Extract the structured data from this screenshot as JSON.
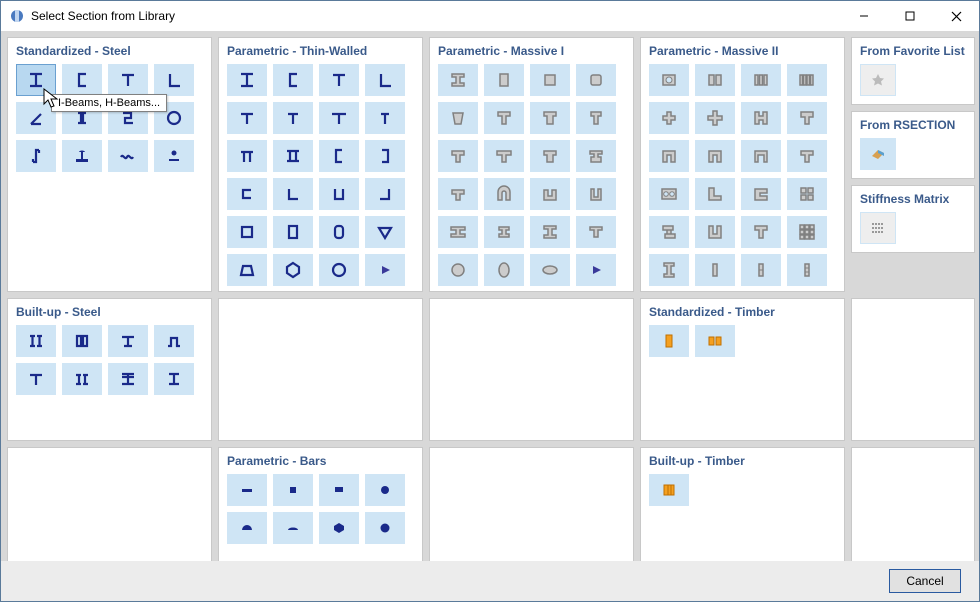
{
  "window": {
    "title": "Select Section from Library"
  },
  "panels": {
    "std_steel": {
      "title": "Standardized - Steel"
    },
    "thin_walled": {
      "title": "Parametric - Thin-Walled"
    },
    "massive1": {
      "title": "Parametric - Massive I"
    },
    "massive2": {
      "title": "Parametric - Massive II"
    },
    "builtup_steel": {
      "title": "Built-up - Steel"
    },
    "std_timber": {
      "title": "Standardized - Timber"
    },
    "bars": {
      "title": "Parametric - Bars"
    },
    "builtup_timber": {
      "title": "Built-up - Timber"
    },
    "favorite": {
      "title": "From Favorite List"
    },
    "rsection": {
      "title": "From RSECTION"
    },
    "stiffness": {
      "title": "Stiffness Matrix"
    }
  },
  "tooltip": {
    "text": "I-Beams, H-Beams..."
  },
  "buttons": {
    "cancel": "Cancel"
  },
  "icons": {
    "std_steel": [
      "i-section",
      "channel",
      "tee",
      "angle",
      "angle-mirror",
      "double-channel",
      "zee",
      "pipe",
      "z-section",
      "wide-flange",
      "wave",
      "round-bar"
    ],
    "thin_walled": [
      "i-thin",
      "channel-thin",
      "tee-thin",
      "angle-thin",
      "tee-flat",
      "tee-alt",
      "tee-wide",
      "tee-narrow",
      "pi",
      "double-i",
      "channel-left",
      "channel-right",
      "c-shape",
      "l-shape",
      "u-shape",
      "l-right",
      "square-hollow",
      "rect-hollow",
      "round-hollow",
      "triangle-hollow",
      "trapezoid",
      "hexagon",
      "circle",
      "more"
    ],
    "massive1": [
      "i-solid",
      "rect-solid",
      "square-solid",
      "rect-tall",
      "trap-solid",
      "t-down",
      "cross",
      "t-up",
      "u-solid",
      "u-wide",
      "t-solid",
      "t-cap",
      "cap",
      "arch",
      "omega",
      "u-narrow",
      "i-wide",
      "i-narrow",
      "h-solid",
      "i-thin",
      "circle-solid",
      "ellipse-h",
      "ellipse-w",
      "more"
    ],
    "massive2": [
      "ring",
      "double-rect",
      "bars-v",
      "bars-dense",
      "cross-solid",
      "plus",
      "h-thick",
      "t-solid",
      "arch-l",
      "arch-r",
      "arch-c",
      "arch-t",
      "double-ring",
      "l-corner",
      "ogee",
      "grid",
      "z-large",
      "u-large",
      "t-large",
      "grid-3x3",
      "i-tall",
      "bars-1",
      "bars-2",
      "bars-3"
    ],
    "builtup_steel": [
      "double-i",
      "box-i",
      "t-comp",
      "hat",
      "t-plate",
      "channel-pair",
      "i-plate",
      "i-welded"
    ],
    "std_timber": [
      "rect-timber",
      "io-timber"
    ],
    "builtup_timber": [
      "lam-timber"
    ],
    "bars": [
      "flat-bar",
      "square-bar",
      "rect-bar",
      "round-bar",
      "half-round",
      "flat-rounded",
      "hex-bar",
      "round-bar-2"
    ]
  }
}
